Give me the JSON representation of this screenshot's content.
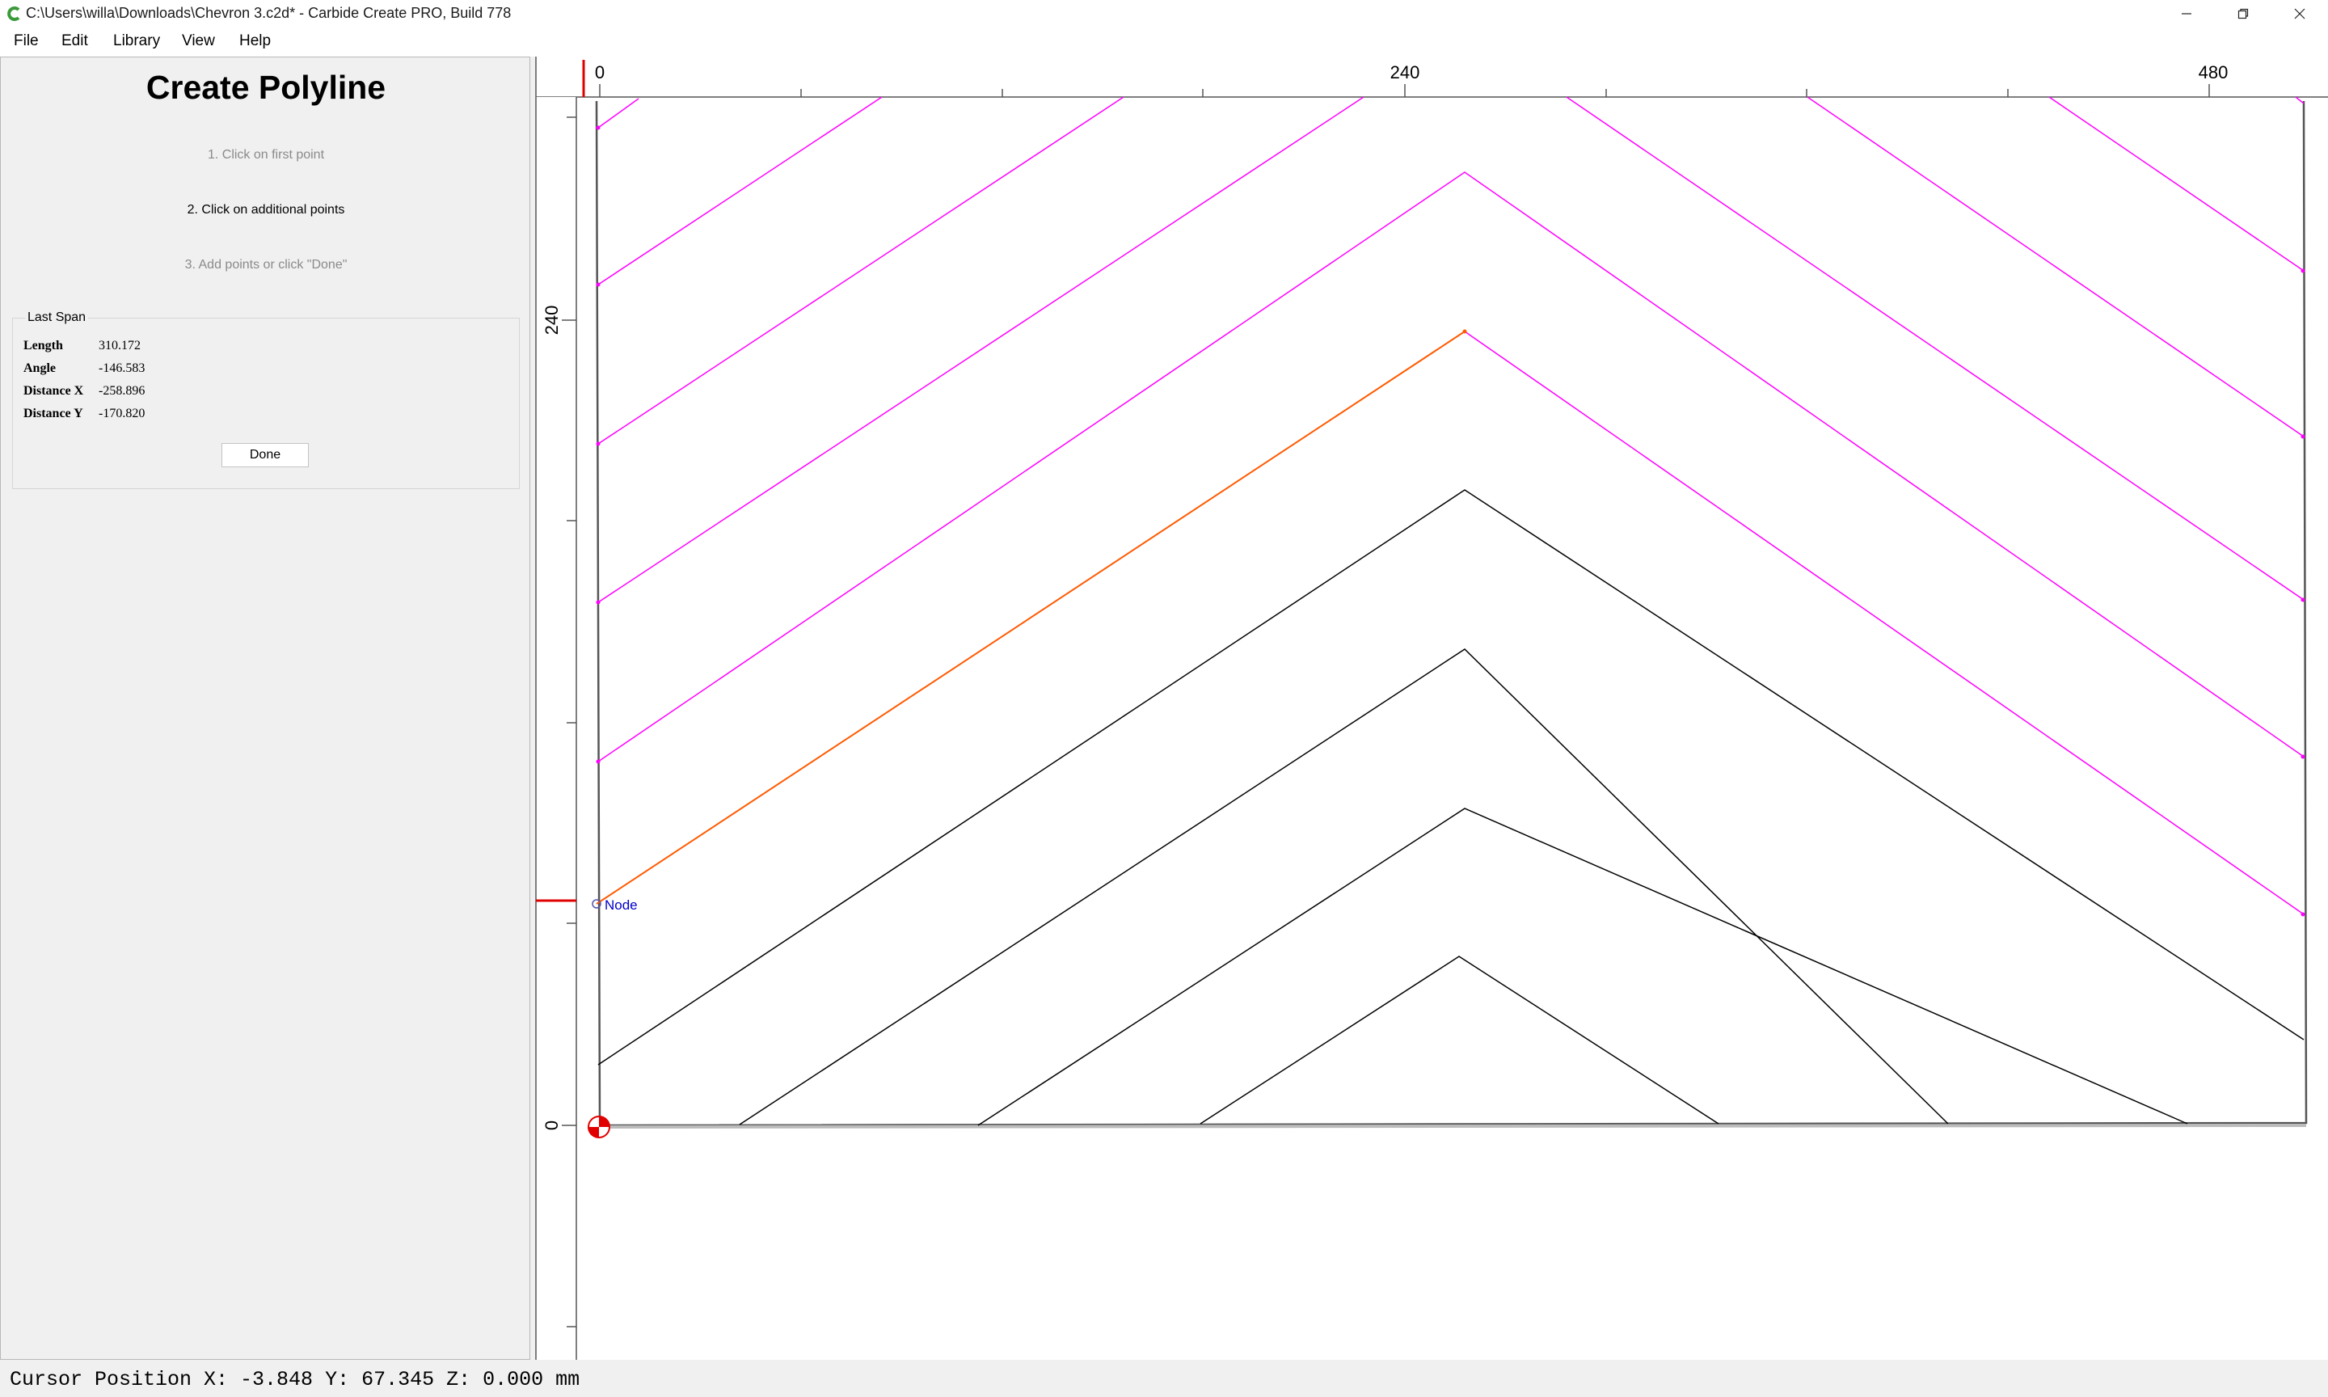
{
  "window": {
    "title": "C:\\Users\\willa\\Downloads\\Chevron 3.c2d* - Carbide Create PRO, Build 778",
    "icon": "carbide-create-icon",
    "controls": [
      "minimize-icon",
      "maximize-icon",
      "close-icon"
    ]
  },
  "menu": [
    "File",
    "Edit",
    "Library",
    "View",
    "Help"
  ],
  "panel": {
    "title": "Create Polyline",
    "steps": [
      "1. Click on first point",
      "2. Click on additional points",
      "3. Add points or click \"Done\""
    ],
    "last_span": {
      "title": "Last Span",
      "rows": [
        {
          "label": "Length",
          "value": "310.172"
        },
        {
          "label": "Angle",
          "value": "-146.583"
        },
        {
          "label": "Distance X",
          "value": "-258.896"
        },
        {
          "label": "Distance Y",
          "value": "-170.820"
        }
      ]
    },
    "done_label": "Done"
  },
  "ruler": {
    "top_labels": [
      "0",
      "240",
      "480"
    ],
    "left_labels": [
      "240",
      "0"
    ]
  },
  "canvas": {
    "node_label": "Node",
    "colors": {
      "selected": "#ff00ff",
      "active": "#ff5a00",
      "normal": "#000000",
      "node_label": "#0000cc",
      "origin": "#e00000"
    }
  },
  "status": {
    "cursor": "Cursor Position X: -3.848 Y: 67.345 Z: 0.000 mm"
  }
}
